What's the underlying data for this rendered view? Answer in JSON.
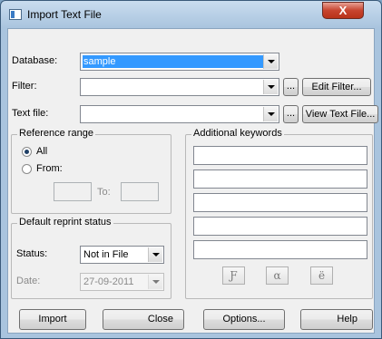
{
  "window": {
    "title": "Import Text File",
    "close_glyph": "X"
  },
  "database": {
    "label": "Database:",
    "value": "sample"
  },
  "filter": {
    "label": "Filter:",
    "value": "",
    "browse": "...",
    "edit_button": "Edit Filter..."
  },
  "text_file": {
    "label": "Text file:",
    "value": "",
    "browse": "...",
    "view_button": "View Text File..."
  },
  "reference_range": {
    "title": "Reference range",
    "all_label": "All",
    "from_label": "From:",
    "to_label": "To:",
    "selected": "All"
  },
  "reprint": {
    "title": "Default reprint status",
    "status_label": "Status:",
    "status_value": "Not in File",
    "date_label": "Date:",
    "date_value": "27-09-2011"
  },
  "keywords": {
    "title": "Additional keywords",
    "count": 5,
    "char_buttons": [
      "Ƒ",
      "α",
      "ë"
    ]
  },
  "buttons": {
    "import": "Import",
    "close": "Close",
    "options": "Options...",
    "help": "Help"
  }
}
